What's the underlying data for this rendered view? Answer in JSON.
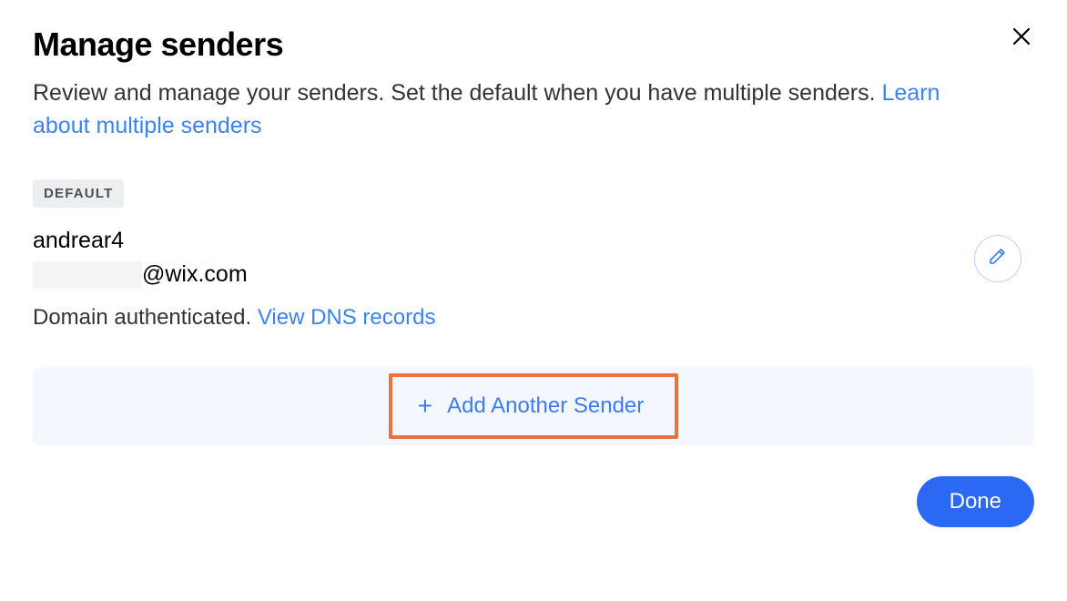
{
  "dialog": {
    "title": "Manage senders",
    "description_prefix": "Review and manage your senders. Set the default when you have multiple senders. ",
    "learn_link": "Learn about multiple senders"
  },
  "badge": {
    "default_label": "DEFAULT"
  },
  "sender": {
    "name": "andrear4",
    "email_suffix": "@wix.com",
    "status_prefix": "Domain authenticated. ",
    "dns_link": "View DNS records"
  },
  "actions": {
    "add_sender_label": "Add Another Sender",
    "done_label": "Done"
  }
}
